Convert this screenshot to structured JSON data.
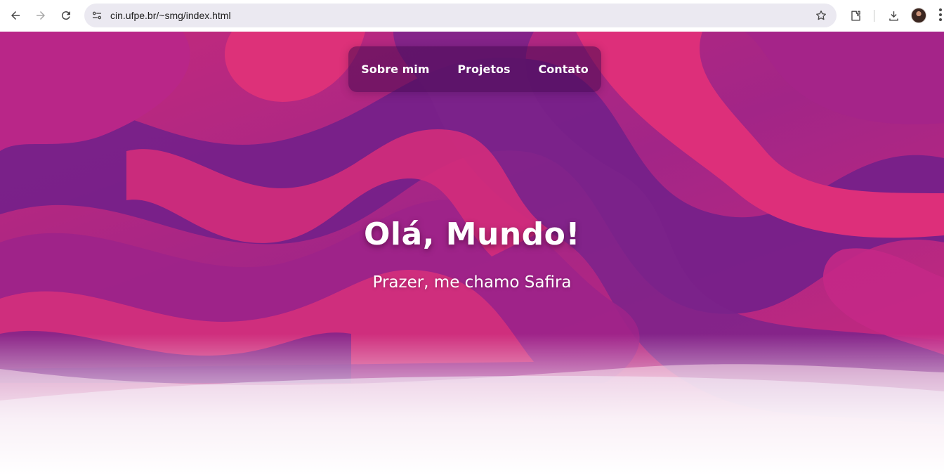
{
  "browser": {
    "url": "cin.ufpe.br/~smg/index.html",
    "icons": [
      "back-arrow-icon",
      "forward-arrow-icon",
      "reload-icon",
      "site-info-icon",
      "bookmark-star-icon",
      "extensions-icon",
      "download-icon",
      "profile-avatar",
      "kebab-menu-icon"
    ]
  },
  "nav": {
    "items": [
      {
        "label": "Sobre mim"
      },
      {
        "label": "Projetos"
      },
      {
        "label": "Contato"
      }
    ]
  },
  "hero": {
    "title": "Olá, Mundo!",
    "subtitle": "Prazer, me chamo Safira"
  },
  "colors": {
    "pink": "#d42c7c",
    "magenta": "#a92489",
    "purple": "#6f2286",
    "nav_bg": "#4a0f55"
  }
}
